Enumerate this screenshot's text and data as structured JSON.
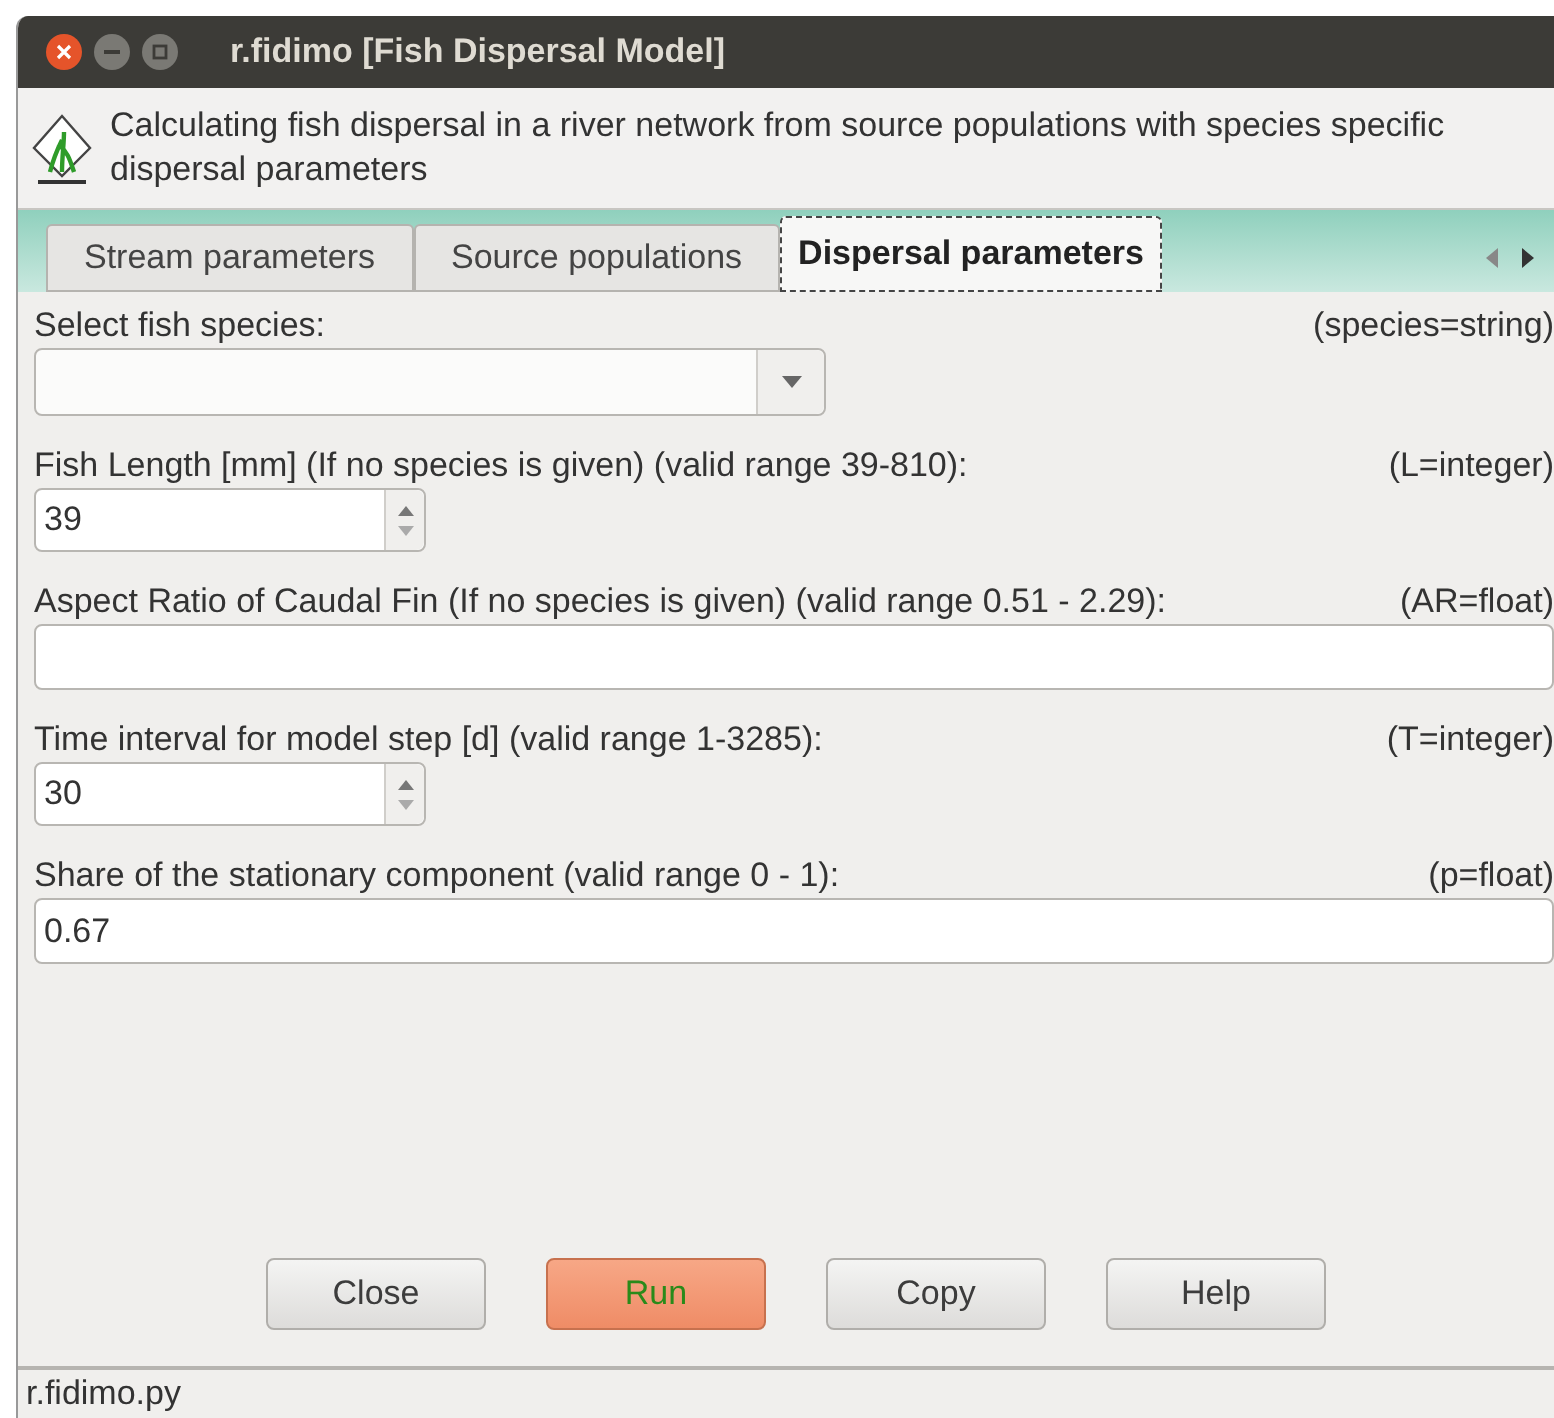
{
  "window": {
    "title": "r.fidimo [Fish Dispersal Model]"
  },
  "description": "Calculating fish dispersal in a river network from source populations with species specific dispersal parameters",
  "tabs": [
    {
      "label": "Stream parameters",
      "selected": false
    },
    {
      "label": "Source populations",
      "selected": false
    },
    {
      "label": "Dispersal parameters",
      "selected": true
    }
  ],
  "fields": [
    {
      "kind": "combo",
      "label": "Select fish species:",
      "param": "(species=string)"
    },
    {
      "kind": "spin",
      "label": "Fish Length [mm] (If no species is given) (valid range 39-810):",
      "param": "(L=integer)",
      "value": "39"
    },
    {
      "kind": "text",
      "label": "Aspect Ratio of Caudal Fin (If no species is given) (valid range 0.51 - 2.29):",
      "param": "(AR=float)"
    },
    {
      "kind": "spin",
      "label": "Time interval for model step [d] (valid range 1-3285):",
      "param": "(T=integer)",
      "value": "30"
    },
    {
      "kind": "text",
      "label": "Share of the stationary component (valid range 0 - 1):",
      "param": "(p=float)",
      "value": "0.67"
    }
  ],
  "buttons": [
    {
      "label": "Close",
      "kind": "normal"
    },
    {
      "label": "Run",
      "kind": "primary"
    },
    {
      "label": "Copy",
      "kind": "normal"
    },
    {
      "label": "Help",
      "kind": "normal"
    }
  ],
  "status_bar": "r.fidimo.py"
}
